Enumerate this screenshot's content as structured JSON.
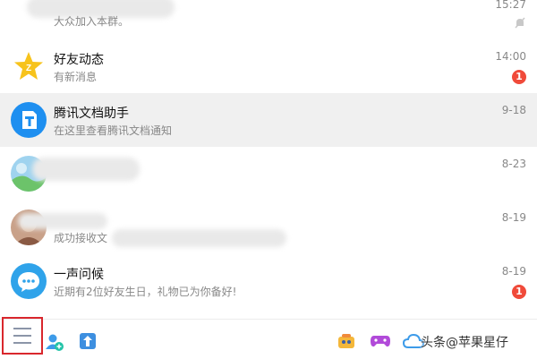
{
  "conversations": [
    {
      "title": "",
      "subtitle": "大众加入本群。",
      "time": "15:27",
      "muted": true
    },
    {
      "title": "好友动态",
      "subtitle": "有新消息",
      "time": "14:00",
      "badge": "1"
    },
    {
      "title": "腾讯文档助手",
      "subtitle": "在这里查看腾讯文档通知",
      "time": "9-18",
      "selected": true
    },
    {
      "title": "",
      "subtitle": "",
      "time": "8-23"
    },
    {
      "title": "",
      "subtitle": "成功接收文",
      "time": "8-19"
    },
    {
      "title": "一声问候",
      "subtitle": "近期有2位好友生日，礼物已为你备好!",
      "time": "8-19",
      "badge": "1"
    }
  ],
  "icons": {
    "qzone": "star-icon",
    "docs": "document-icon",
    "greeting": "chat-bubble-icon",
    "menu": "hamburger-menu-icon",
    "add_contact": "add-contact-icon",
    "upload": "upload-icon",
    "face": "face-icon",
    "game": "gamepad-icon",
    "cloud": "cloud-icon"
  },
  "watermark": "头条@苹果星仔",
  "colors": {
    "badge": "#f04a3a",
    "selected_row": "#f0f0f0",
    "highlight_box": "#d9272d",
    "qq_blue": "#1e8ff0"
  }
}
